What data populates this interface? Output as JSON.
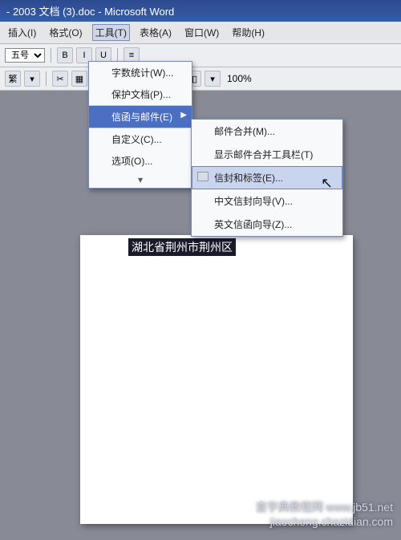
{
  "title": "- 2003 文档 (3).doc - Microsoft Word",
  "menubar": {
    "insert": "插入(I)",
    "format": "格式(O)",
    "tools": "工具(T)",
    "table": "表格(A)",
    "window": "窗口(W)",
    "help": "帮助(H)"
  },
  "toolbar": {
    "font_size": "五号",
    "trad_simp": "繁",
    "zoom": "100%"
  },
  "tools_menu": {
    "word_count": "字数统计(W)...",
    "protect": "保护文档(P)...",
    "letters_mail": "信函与邮件(E)",
    "customize": "自定义(C)...",
    "options": "选项(O)..."
  },
  "letters_submenu": {
    "mail_merge": "邮件合并(M)...",
    "show_toolbar": "显示邮件合并工具栏(T)",
    "envelopes_labels": "信封和标签(E)...",
    "chinese_envelope": "中文信封向导(V)...",
    "english_letter": "英文信函向导(Z)..."
  },
  "document": {
    "selected_text": "湖北省荆州市荆州区"
  },
  "watermark": {
    "line1": "查字典教程网 www.jb51.net",
    "line2": "jiaocheng.chazidian.com"
  }
}
